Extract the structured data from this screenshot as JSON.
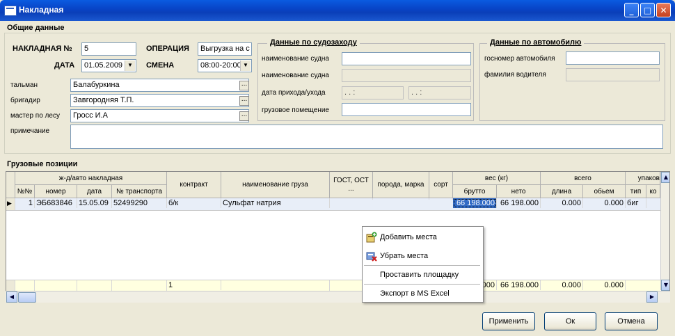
{
  "window": {
    "title": "Накладная",
    "min": "_",
    "max": "□",
    "close": "✕"
  },
  "general": {
    "section": "Общие данные",
    "invoice_label": "НАКЛАДНАЯ №",
    "invoice_value": "5",
    "operation_label": "ОПЕРАЦИЯ",
    "operation_value": "Выгрузка на с",
    "date_label": "ДАТА",
    "date_value": "01.05.2009",
    "shift_label": "СМЕНА",
    "shift_value": "08:00-20:00",
    "tallyman_label": "тальман",
    "tallyman_value": "Балабуркина",
    "foreman_label": "бригадир",
    "foreman_value": "Завгородняя Т.П.",
    "master_label": "мастер по лесу",
    "master_value": "Гросс И.А",
    "note_label": "примечание",
    "note_value": "",
    "dots": "..."
  },
  "ship": {
    "title": "Данные по судозаходу",
    "name_label": "наименование судна",
    "name_value": "",
    "name2_label": "наименование судна",
    "name2_value": "",
    "arrival_label": "дата прихода/ухода",
    "arrival_value": ". .   :",
    "departure_value": ". .   :",
    "hold_label": "грузовое помещение",
    "hold_value": ""
  },
  "auto": {
    "title": "Данные по автомобилю",
    "plate_label": "госномер автомобиля",
    "plate_value": "",
    "driver_label": "фамилия водителя",
    "driver_value": ""
  },
  "cargo": {
    "section": "Грузовые позиции",
    "headers": {
      "rail_group": "ж-д/авто накладная",
      "num": "№№",
      "number": "номер",
      "date": "дата",
      "transport": "№ транспорта",
      "contract": "контракт",
      "cargo_name": "наименование груза",
      "gost": "ГОСТ, ОСТ ...",
      "breed": "порода, марка",
      "sort": "сорт",
      "weight_group": "вес (кг)",
      "gross": "брутто",
      "net": "нето",
      "total_group": "всего",
      "length": "длина",
      "volume": "обьем",
      "pack_group": "упаков",
      "type": "тип",
      "ko": "ко"
    },
    "row": {
      "num": "1",
      "number": "ЭБ683846",
      "date": "15.05.09",
      "transport": "52499290",
      "contract": "б/к",
      "cargo_name": "Сульфат натрия",
      "gost": "",
      "breed": "",
      "sort": "",
      "gross": "66 198.000",
      "net": "66 198.000",
      "length": "0.000",
      "volume": "0.000",
      "type": "биг"
    },
    "totals": {
      "contract": "1",
      "gross": "000",
      "net": "66 198.000",
      "length": "0.000",
      "volume": "0.000"
    }
  },
  "context_menu": {
    "add": "Добавить места",
    "remove": "Убрать места",
    "area": "Проставить площадку",
    "export": "Экспорт в MS Excel"
  },
  "buttons": {
    "apply": "Применить",
    "ok": "Ок",
    "cancel": "Отмена"
  },
  "colors": {
    "title_bar": "#0a4fd0",
    "selection": "#316ac5",
    "totals_row": "#ffffe0"
  }
}
